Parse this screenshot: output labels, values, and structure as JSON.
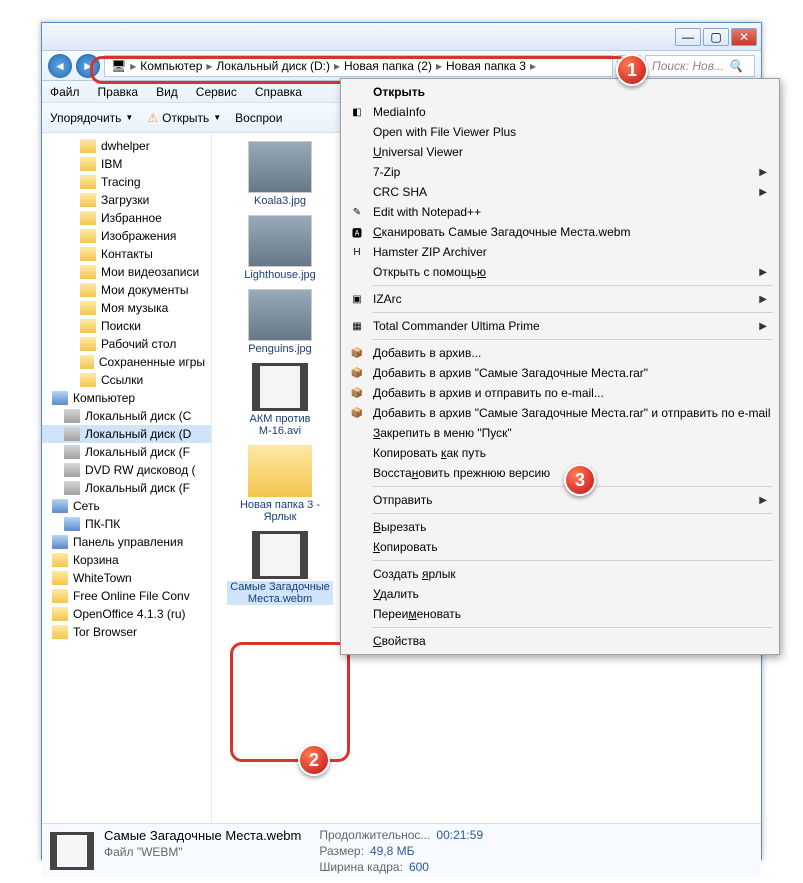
{
  "breadcrumb": [
    "Компьютер",
    "Локальный диск (D:)",
    "Новая папка (2)",
    "Новая папка 3"
  ],
  "search_placeholder": "Поиск: Нов...",
  "menubar": [
    "Файл",
    "Правка",
    "Вид",
    "Сервис",
    "Справка"
  ],
  "toolbar": {
    "organize": "Упорядочить",
    "open": "Открыть",
    "repro": "Воспрои"
  },
  "tree": [
    {
      "l": 2,
      "t": "folder",
      "label": "dwhelper"
    },
    {
      "l": 2,
      "t": "folder",
      "label": "IBM"
    },
    {
      "l": 2,
      "t": "folder",
      "label": "Tracing"
    },
    {
      "l": 2,
      "t": "folder",
      "label": "Загрузки"
    },
    {
      "l": 2,
      "t": "folder",
      "label": "Избранное"
    },
    {
      "l": 2,
      "t": "folder",
      "label": "Изображения"
    },
    {
      "l": 2,
      "t": "folder",
      "label": "Контакты"
    },
    {
      "l": 2,
      "t": "folder",
      "label": "Мои видеозаписи"
    },
    {
      "l": 2,
      "t": "folder",
      "label": "Мои документы"
    },
    {
      "l": 2,
      "t": "folder",
      "label": "Моя музыка"
    },
    {
      "l": 2,
      "t": "folder",
      "label": "Поиски"
    },
    {
      "l": 2,
      "t": "folder",
      "label": "Рабочий стол"
    },
    {
      "l": 2,
      "t": "folder",
      "label": "Сохраненные игры"
    },
    {
      "l": 2,
      "t": "folder",
      "label": "Ссылки"
    },
    {
      "l": 0,
      "t": "comp",
      "label": "Компьютер"
    },
    {
      "l": 1,
      "t": "drive",
      "label": "Локальный диск (C"
    },
    {
      "l": 1,
      "t": "drive",
      "label": "Локальный диск (D",
      "sel": true
    },
    {
      "l": 1,
      "t": "drive",
      "label": "Локальный диск (F"
    },
    {
      "l": 1,
      "t": "drive",
      "label": "DVD RW дисковод ("
    },
    {
      "l": 1,
      "t": "drive",
      "label": "Локальный диск (F"
    },
    {
      "l": 0,
      "t": "comp",
      "label": "Сеть"
    },
    {
      "l": 1,
      "t": "comp",
      "label": "ПК-ПК"
    },
    {
      "l": 0,
      "t": "comp",
      "label": "Панель управления"
    },
    {
      "l": 0,
      "t": "folder",
      "label": "Корзина"
    },
    {
      "l": 0,
      "t": "folder",
      "label": "WhiteTown"
    },
    {
      "l": 0,
      "t": "folder",
      "label": "Free Online File Conv"
    },
    {
      "l": 0,
      "t": "folder",
      "label": "OpenOffice 4.1.3 (ru)"
    },
    {
      "l": 0,
      "t": "folder",
      "label": "Tor Browser"
    }
  ],
  "files": [
    {
      "name": "Koala3.jpg",
      "type": "img"
    },
    {
      "name": "Lighthouse.jpg",
      "type": "img"
    },
    {
      "name": "Penguins.jpg",
      "type": "img"
    },
    {
      "name": "АКМ против М-16.avi",
      "type": "video"
    },
    {
      "name": "Новая папка 3 - Ярлык",
      "type": "folder"
    },
    {
      "name": "Самые Загадочные Места.webm",
      "type": "video",
      "sel": true
    }
  ],
  "ctx": [
    {
      "label": "Открыть",
      "bold": true
    },
    {
      "label": "MediaInfo",
      "icon": "◧"
    },
    {
      "label": "Open with File Viewer Plus"
    },
    {
      "label": "Universal Viewer",
      "u": "U"
    },
    {
      "label": "7-Zip",
      "sub": true
    },
    {
      "label": "CRC SHA",
      "sub": true
    },
    {
      "label": "Edit with Notepad++",
      "icon": "✎"
    },
    {
      "label": "Сканировать Самые Загадочные Места.webm",
      "icon": "🅰",
      "u": "С"
    },
    {
      "label": "Hamster ZIP Archiver",
      "icon": "H"
    },
    {
      "label": "Открыть с помощью",
      "sub": true,
      "u": "ю"
    },
    {
      "sep": true
    },
    {
      "label": "IZArc",
      "sub": true,
      "icon": "▣"
    },
    {
      "sep": true
    },
    {
      "label": "Total Commander Ultima Prime",
      "sub": true,
      "icon": "▦"
    },
    {
      "sep": true
    },
    {
      "label": "Добавить в архив...",
      "icon": "📦"
    },
    {
      "label": "Добавить в архив \"Самые Загадочные Места.rar\"",
      "icon": "📦"
    },
    {
      "label": "Добавить в архив и отправить по e-mail...",
      "icon": "📦"
    },
    {
      "label": "Добавить в архив \"Самые Загадочные Места.rar\" и отправить по e-mail",
      "icon": "📦"
    },
    {
      "label": "Закрепить в меню \"Пуск\"",
      "u": "З"
    },
    {
      "label": "Копировать как путь",
      "u": "к",
      "hl": true
    },
    {
      "label": "Восстановить прежнюю версию",
      "u": "н"
    },
    {
      "sep": true
    },
    {
      "label": "Отправить",
      "sub": true
    },
    {
      "sep": true
    },
    {
      "label": "Вырезать",
      "u": "В"
    },
    {
      "label": "Копировать",
      "u": "К"
    },
    {
      "sep": true
    },
    {
      "label": "Создать ярлык",
      "u": "я"
    },
    {
      "label": "Удалить",
      "u": "У"
    },
    {
      "label": "Переименовать",
      "u": "м"
    },
    {
      "sep": true
    },
    {
      "label": "Свойства",
      "u": "С"
    }
  ],
  "status": {
    "name": "Самые Загадочные Места.webm",
    "type": "Файл \"WEBM\"",
    "duration_lbl": "Продолжительнос...",
    "duration": "00:21:59",
    "size_lbl": "Размер:",
    "size": "49,8 МБ",
    "width_lbl": "Ширина кадра:",
    "width": "600"
  }
}
